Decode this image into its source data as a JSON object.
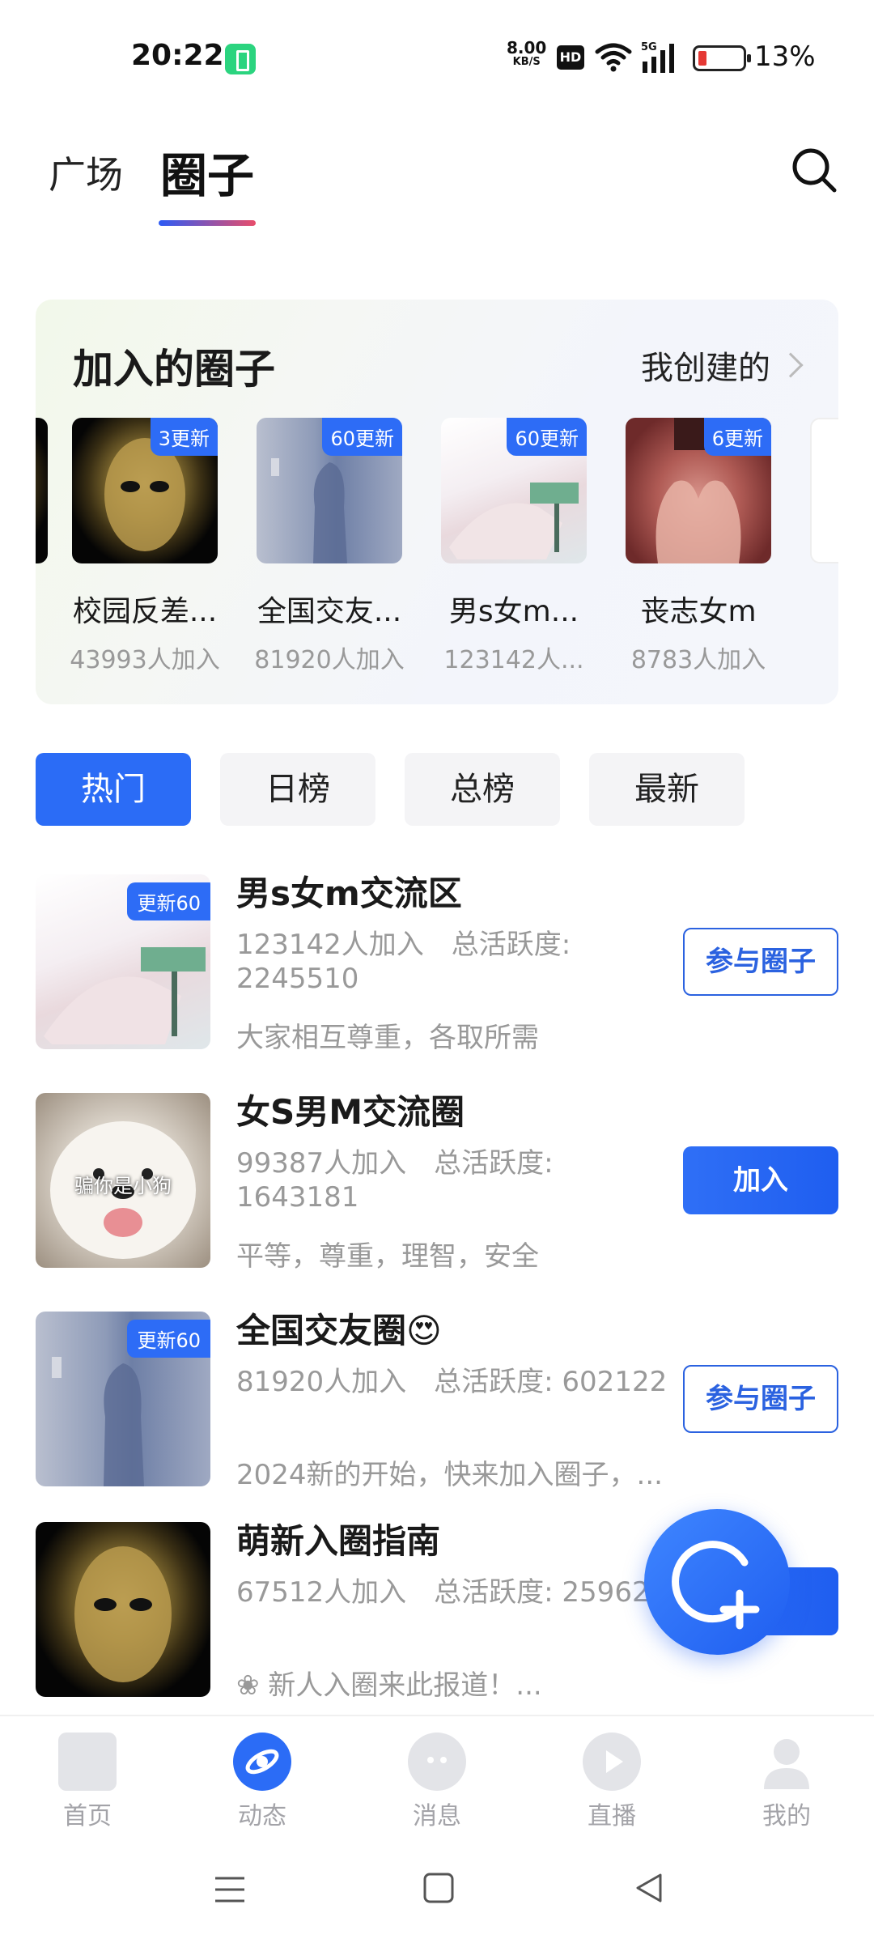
{
  "status_bar": {
    "time": "20:22",
    "net_speed_value": "8.00",
    "net_speed_unit": "KB/S",
    "hd": "HD",
    "signal_label": "5G",
    "battery_percent": "13%"
  },
  "header": {
    "tabs": [
      {
        "label": "广场",
        "active": false
      },
      {
        "label": "圈子",
        "active": true
      }
    ],
    "search_icon": "search-icon"
  },
  "joined": {
    "title": "加入的圈子",
    "my_created": "我创建的",
    "items": [
      {
        "name": "校园反差...",
        "count": "43993人加入",
        "badge": "3更新",
        "image": "gold-mask"
      },
      {
        "name": "全国交友...",
        "count": "81920人加入",
        "badge": "60更新",
        "image": "shadow-wall"
      },
      {
        "name": "男s女m...",
        "count": "123142人...",
        "badge": "60更新",
        "image": "anime-girl"
      },
      {
        "name": "丧志女m",
        "count": "8783人加入",
        "badge": "6更新",
        "image": "hands"
      }
    ]
  },
  "filters": [
    {
      "label": "热门",
      "active": true
    },
    {
      "label": "日榜",
      "active": false
    },
    {
      "label": "总榜",
      "active": false
    },
    {
      "label": "最新",
      "active": false
    }
  ],
  "circles": [
    {
      "title": "男s女m交流区",
      "stats": "123142人加入　总活跃度: 2245510",
      "desc": "大家相互尊重，各取所需",
      "badge": "更新60",
      "action": "参与圈子",
      "action_type": "participate",
      "image": "anime-girl"
    },
    {
      "title": "女S男M交流圈",
      "stats": "99387人加入　总活跃度: 1643181",
      "desc": "平等，尊重，理智，安全",
      "badge": "",
      "action": "加入",
      "action_type": "join",
      "image": "dog",
      "image_caption": "骗你是小狗"
    },
    {
      "title": "全国交友圈😍",
      "stats": "81920人加入　总活跃度: 602122",
      "desc": "2024新的开始，快来加入圈子，...",
      "badge": "更新60",
      "action": "参与圈子",
      "action_type": "participate",
      "image": "shadow-wall"
    },
    {
      "title": "萌新入圈指南",
      "stats": "67512人加入　总活跃度: 25962",
      "desc": "❀ 新人入圈来此报道！...",
      "badge": "",
      "action": "",
      "action_type": "join",
      "image": "gold-mask"
    }
  ],
  "fab": {
    "icon": "add-circle-icon"
  },
  "bottom_nav": [
    {
      "label": "首页",
      "icon": "home-icon",
      "active": false
    },
    {
      "label": "动态",
      "icon": "planet-icon",
      "active": true
    },
    {
      "label": "消息",
      "icon": "chat-icon",
      "active": false
    },
    {
      "label": "直播",
      "icon": "play-icon",
      "active": false
    },
    {
      "label": "我的",
      "icon": "user-icon",
      "active": false
    }
  ],
  "system_nav": {
    "icons": [
      "menu-icon",
      "home-square-icon",
      "back-icon"
    ]
  },
  "colors": {
    "accent": "#2b6cf6",
    "muted": "#999999",
    "title": "#1a1a1a"
  }
}
